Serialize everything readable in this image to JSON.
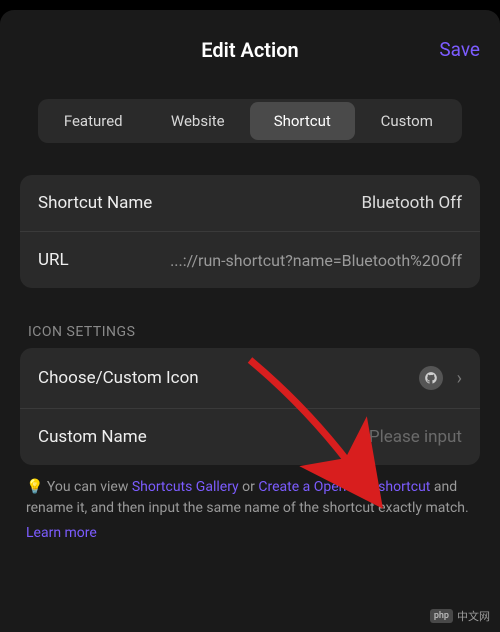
{
  "header": {
    "title": "Edit Action",
    "save_label": "Save"
  },
  "tabs": {
    "featured": "Featured",
    "website": "Website",
    "shortcut": "Shortcut",
    "custom": "Custom"
  },
  "shortcut": {
    "name_label": "Shortcut Name",
    "name_value": "Bluetooth Off",
    "url_label": "URL",
    "url_value": "...://run-shortcut?name=Bluetooth%20Off"
  },
  "icon_section": {
    "header": "ICON SETTINGS",
    "choose_label": "Choose/Custom Icon",
    "custom_name_label": "Custom Name",
    "custom_name_placeholder": "Please input"
  },
  "hint": {
    "bulb": "💡",
    "t1": "You can view ",
    "link1": "Shortcuts Gallery",
    "t2": " or ",
    "link2": "Create a Open App shortcut",
    "t3": " and rename it, and then input the same name of the shortcut exactly match.",
    "learn_more": "Learn more"
  },
  "watermark": {
    "badge": "php",
    "text": "中文网"
  }
}
